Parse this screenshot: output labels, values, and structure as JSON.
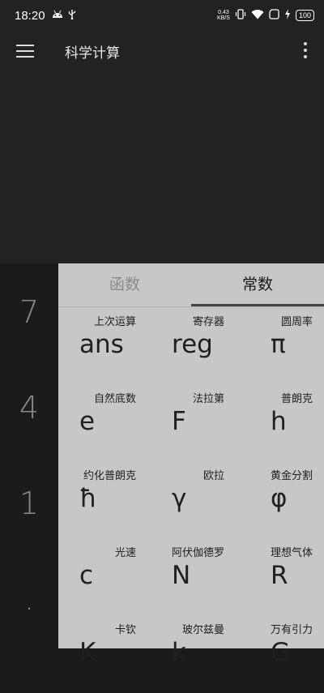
{
  "status_bar": {
    "time": "18:20",
    "net_speed_value": "0.43",
    "net_speed_unit": "KB/S",
    "battery": "100"
  },
  "toolbar": {
    "title": "科学计算"
  },
  "keypad": {
    "digits": [
      "7",
      "4",
      "1",
      "."
    ]
  },
  "tabs": [
    {
      "label": "函数",
      "active": false
    },
    {
      "label": "常数",
      "active": true
    }
  ],
  "constants": [
    {
      "label": "上次运算",
      "symbol": "ans"
    },
    {
      "label": "寄存器",
      "symbol": "reg"
    },
    {
      "label": "圆周率",
      "symbol": "π"
    },
    {
      "label": "自然底数",
      "symbol": "e"
    },
    {
      "label": "法拉第",
      "symbol": "F"
    },
    {
      "label": "普朗克",
      "symbol": "h"
    },
    {
      "label": "约化普朗克",
      "symbol": "ħ"
    },
    {
      "label": "欧拉",
      "symbol": "γ"
    },
    {
      "label": "黄金分割",
      "symbol": "φ"
    },
    {
      "label": "光速",
      "symbol": "c"
    },
    {
      "label": "阿伏伽德罗",
      "symbol": "N"
    },
    {
      "label": "理想气体",
      "symbol": "R"
    },
    {
      "label": "卡钦",
      "symbol": "K"
    },
    {
      "label": "玻尔兹曼",
      "symbol": "k"
    },
    {
      "label": "万有引力",
      "symbol": "G"
    }
  ],
  "colors": {
    "bar_bg": "#222222",
    "panel_bg": "#c7c7c7",
    "keypad_bg": "#1b1b1b"
  },
  "icons": [
    "android-icon",
    "usb-icon",
    "vibrate-icon",
    "wifi-icon",
    "sim-icon",
    "charging-icon",
    "menu-icon",
    "more-vert-icon"
  ]
}
